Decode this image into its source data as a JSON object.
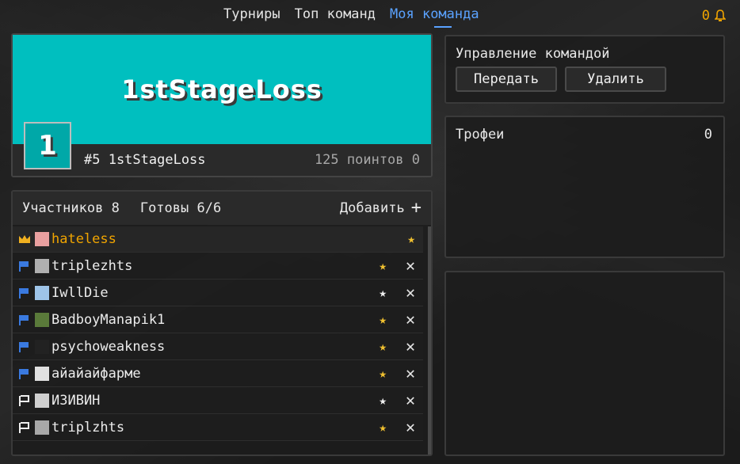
{
  "nav": {
    "tabs": [
      {
        "label": "Турниры"
      },
      {
        "label": "Топ команд"
      },
      {
        "label": "Моя команда"
      }
    ],
    "notifications_count": "0",
    "accent": "#5aa2ff"
  },
  "team": {
    "banner_name": "1stStageLoss",
    "badge": "1",
    "rank_line": "#5 1stStageLoss",
    "points_line": "125 поинтов 0",
    "banner_color": "#00bfbf"
  },
  "members": {
    "count_label": "Участников 8",
    "ready_label": "Готовы 6/6",
    "add_label": "Добавить",
    "rows": [
      {
        "name": "hateless",
        "role": "crown-icon",
        "star": "gold",
        "leader": true
      },
      {
        "name": "triplezhts",
        "role": "blue-flag-icon",
        "star": "gold"
      },
      {
        "name": "IwllDie",
        "role": "blue-flag-icon",
        "star": "white"
      },
      {
        "name": "BadboyManapik1",
        "role": "blue-flag-icon",
        "star": "gold"
      },
      {
        "name": "psychoweakness",
        "role": "blue-flag-icon",
        "star": "gold"
      },
      {
        "name": "айайайфарме",
        "role": "blue-flag-icon",
        "star": "gold"
      },
      {
        "name": "ИЗИВИН",
        "role": "white-flag-icon",
        "star": "white"
      },
      {
        "name": "triplzhts",
        "role": "white-flag-icon",
        "star": "gold"
      }
    ]
  },
  "manage": {
    "title": "Управление командой",
    "transfer_label": "Передать",
    "delete_label": "Удалить"
  },
  "trophies": {
    "title": "Трофеи",
    "count": "0"
  },
  "colors": {
    "gold": "#f0c030",
    "white_star": "#f0f0f0",
    "leader_name": "#f0a400"
  }
}
